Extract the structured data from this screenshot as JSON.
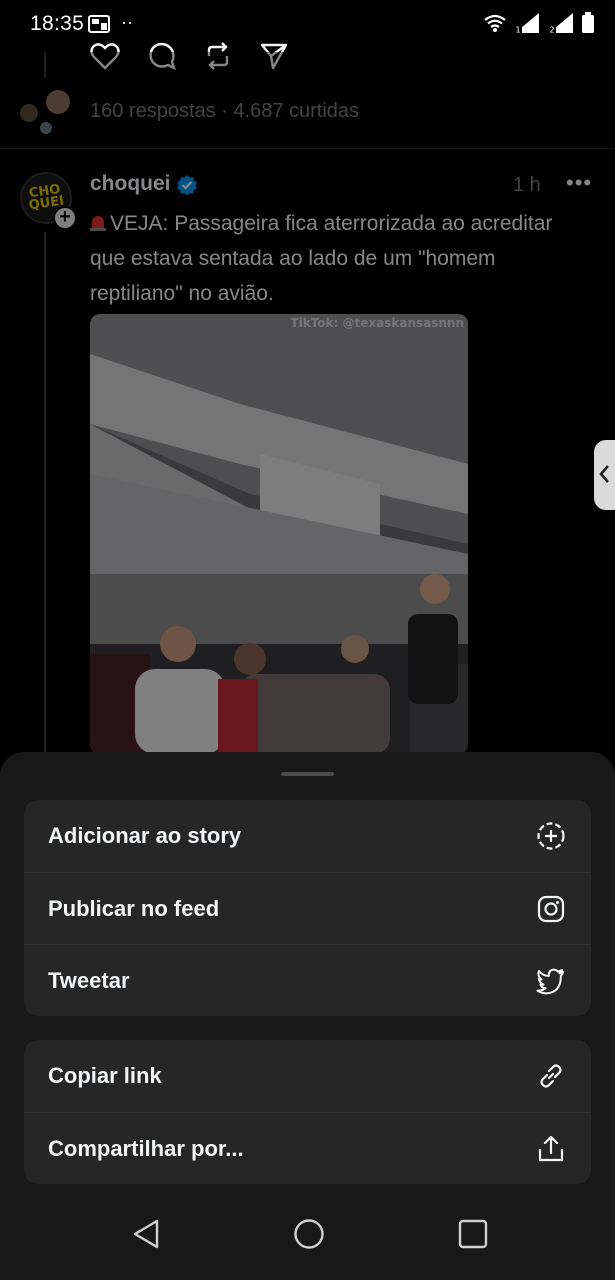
{
  "status_bar": {
    "time": "18:35",
    "indicator": "··"
  },
  "previous_post": {
    "stats": "160 respostas · 4.687 curtidas"
  },
  "post": {
    "username": "choquei",
    "verified": true,
    "time": "1 h",
    "more": "•••",
    "avatar_text": "CHO\nQUEI",
    "text": "VEJA: Passageira fica aterrorizada ao acreditar que estava sentada ao lado de um \"homem reptiliano\" no avião.",
    "video_watermark": "TikTok: @texaskansasnnn"
  },
  "share_sheet": {
    "group1": [
      {
        "label": "Adicionar ao story",
        "icon": "add-story-icon"
      },
      {
        "label": "Publicar no feed",
        "icon": "instagram-icon"
      },
      {
        "label": "Tweetar",
        "icon": "twitter-icon"
      }
    ],
    "group2": [
      {
        "label": "Copiar link",
        "icon": "link-icon"
      },
      {
        "label": "Compartilhar por...",
        "icon": "share-icon"
      }
    ]
  },
  "colors": {
    "background": "#000000",
    "sheet": "#181818",
    "sheet_item": "#262626",
    "verified": "#0095f6"
  }
}
